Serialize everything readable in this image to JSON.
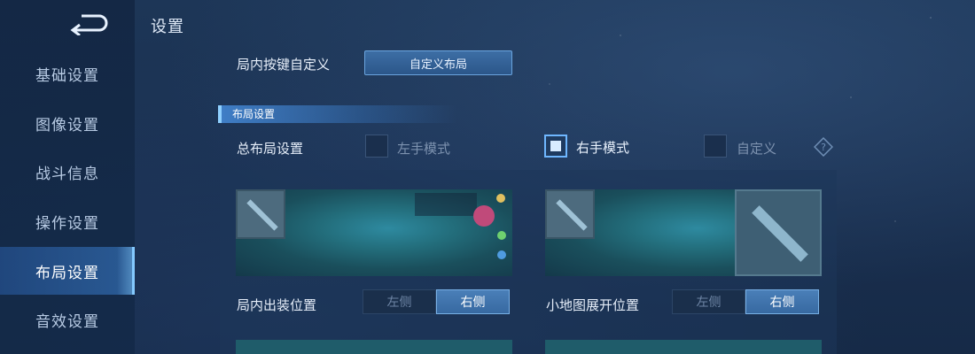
{
  "sidebar": {
    "items": [
      {
        "label": "基础设置",
        "active": false
      },
      {
        "label": "图像设置",
        "active": false
      },
      {
        "label": "战斗信息",
        "active": false
      },
      {
        "label": "操作设置",
        "active": false
      },
      {
        "label": "布局设置",
        "active": true
      },
      {
        "label": "音效设置",
        "active": false
      }
    ]
  },
  "header": {
    "title": "设置"
  },
  "custom_keys": {
    "label": "局内按键自定义",
    "button_label": "自定义布局"
  },
  "layout_section": {
    "title": "布局设置",
    "overall": {
      "label": "总布局设置",
      "options": [
        {
          "label": "左手模式",
          "checked": false
        },
        {
          "label": "右手模式",
          "checked": true
        },
        {
          "label": "自定义",
          "checked": false
        }
      ]
    },
    "shop_position": {
      "label": "局内出装位置",
      "options": [
        "左侧",
        "右侧"
      ],
      "selected": "右侧"
    },
    "minimap_position": {
      "label": "小地图展开位置",
      "options": [
        "左侧",
        "右侧"
      ],
      "selected": "右侧"
    }
  },
  "colors": {
    "accent": "#3f72ab",
    "active_nav": "#3a82cc",
    "text": "#e6eef9"
  }
}
